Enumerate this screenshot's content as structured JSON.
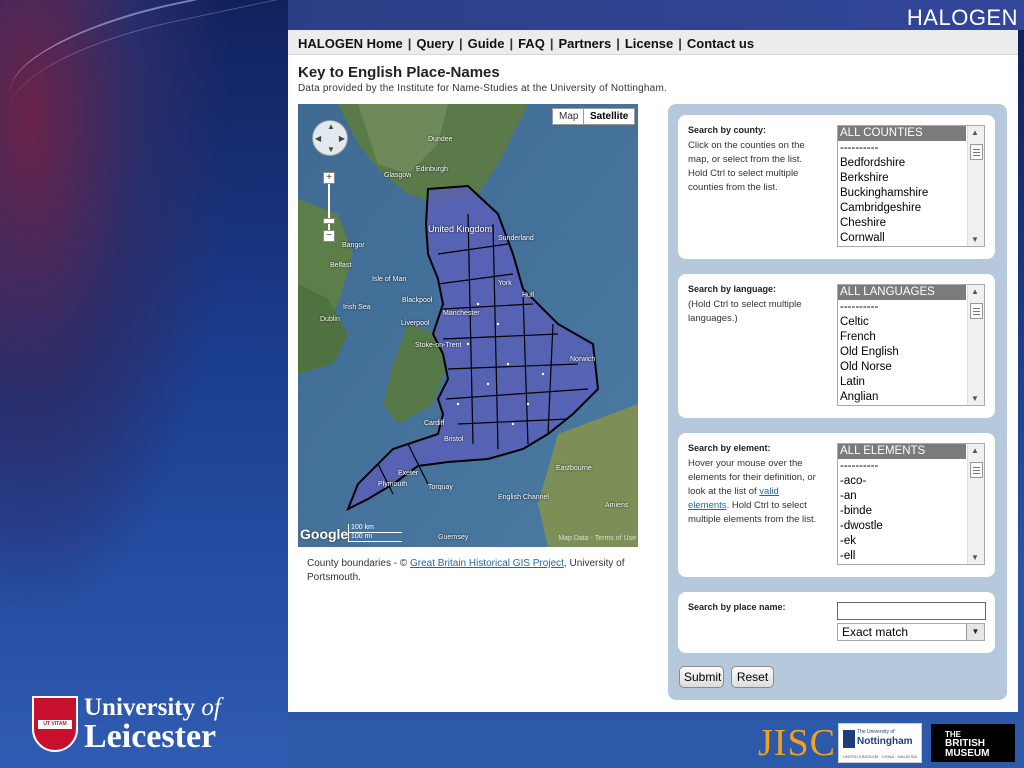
{
  "brand": "HALOGEN",
  "nav": {
    "items": [
      "HALOGEN Home",
      "Query",
      "Guide",
      "FAQ",
      "Partners",
      "License",
      "Contact us"
    ],
    "separator": "|"
  },
  "page": {
    "title": "Key to English Place-Names",
    "subtitle": "Data provided by the Institute for Name-Studies at the University of Nottingham."
  },
  "map": {
    "type_buttons": [
      "Map",
      "Satellite"
    ],
    "active_type": "Satellite",
    "zoom_in": "+",
    "zoom_out": "−",
    "google_logo": "Google",
    "scale": [
      "100 km",
      "100 mi"
    ],
    "terms": "Map Data - Terms of Use",
    "places": [
      "Dundee",
      "Glasgow",
      "Edinburgh",
      "Belfast",
      "Isle of Man",
      "Dublin",
      "Irish Sea",
      "Blackpool",
      "Liverpool",
      "Stoke-on-Trent",
      "Manchester",
      "Sunderland",
      "York",
      "Hull",
      "Norwich",
      "Cardiff",
      "Bristol",
      "Exeter",
      "Plymouth",
      "Torquay",
      "Eastbourne",
      "English Channel",
      "Guernsey",
      "Amiens",
      "Bangor",
      "United Kingdom"
    ]
  },
  "caption": {
    "prefix": "County boundaries - © ",
    "link": "Great Britain Historical GIS Project",
    "suffix": ", University of Portsmouth."
  },
  "search_county": {
    "label": "Search by county:",
    "help": "Click on the counties on the map, or select from the list. Hold Ctrl to select multiple counties from the list.",
    "options": [
      "ALL COUNTIES",
      "----------",
      "Bedfordshire",
      "Berkshire",
      "Buckinghamshire",
      "Cambridgeshire",
      "Cheshire",
      "Cornwall"
    ],
    "selected": "ALL COUNTIES"
  },
  "search_language": {
    "label": "Search by language:",
    "help": "(Hold Ctrl to select multiple languages.)",
    "options": [
      "ALL LANGUAGES",
      "----------",
      "Celtic",
      "French",
      "Old English",
      "Old Norse",
      "Latin",
      "Anglian"
    ],
    "selected": "ALL LANGUAGES"
  },
  "search_element": {
    "label": "Search by element:",
    "help_prefix": "Hover your mouse over the elements for their definition, or look at the list of ",
    "help_link": "valid elements",
    "help_suffix": ". Hold Ctrl to select multiple elements from the list.",
    "options": [
      "ALL ELEMENTS",
      "----------",
      "-aco-",
      "-an",
      "-binde",
      "-dwostle",
      "-ek",
      "-ell"
    ],
    "selected": "ALL ELEMENTS"
  },
  "search_place": {
    "label": "Search by place name:",
    "value": "",
    "match_selected": "Exact match"
  },
  "buttons": {
    "submit": "Submit",
    "reset": "Reset"
  },
  "logos": {
    "university_line1": "University",
    "university_of": "of",
    "university_line2": "Leicester",
    "shield_motto": "UT VITAM HABEANT",
    "jisc": "JISC",
    "nottingham_line1": "The University of",
    "nottingham_line2": "Nottingham",
    "nottingham_line3": "UNITED KINGDOM · CHINA · MALAYSIA",
    "bm_line1": "THE",
    "bm_line2": "BRITISH",
    "bm_line3": "MUSEUM"
  },
  "colors": {
    "accent_link": "#1f6b9e",
    "panel_bg": "#b6c9dc",
    "selected_option": "#7b7b7b",
    "jisc_orange": "#f3a21c"
  }
}
